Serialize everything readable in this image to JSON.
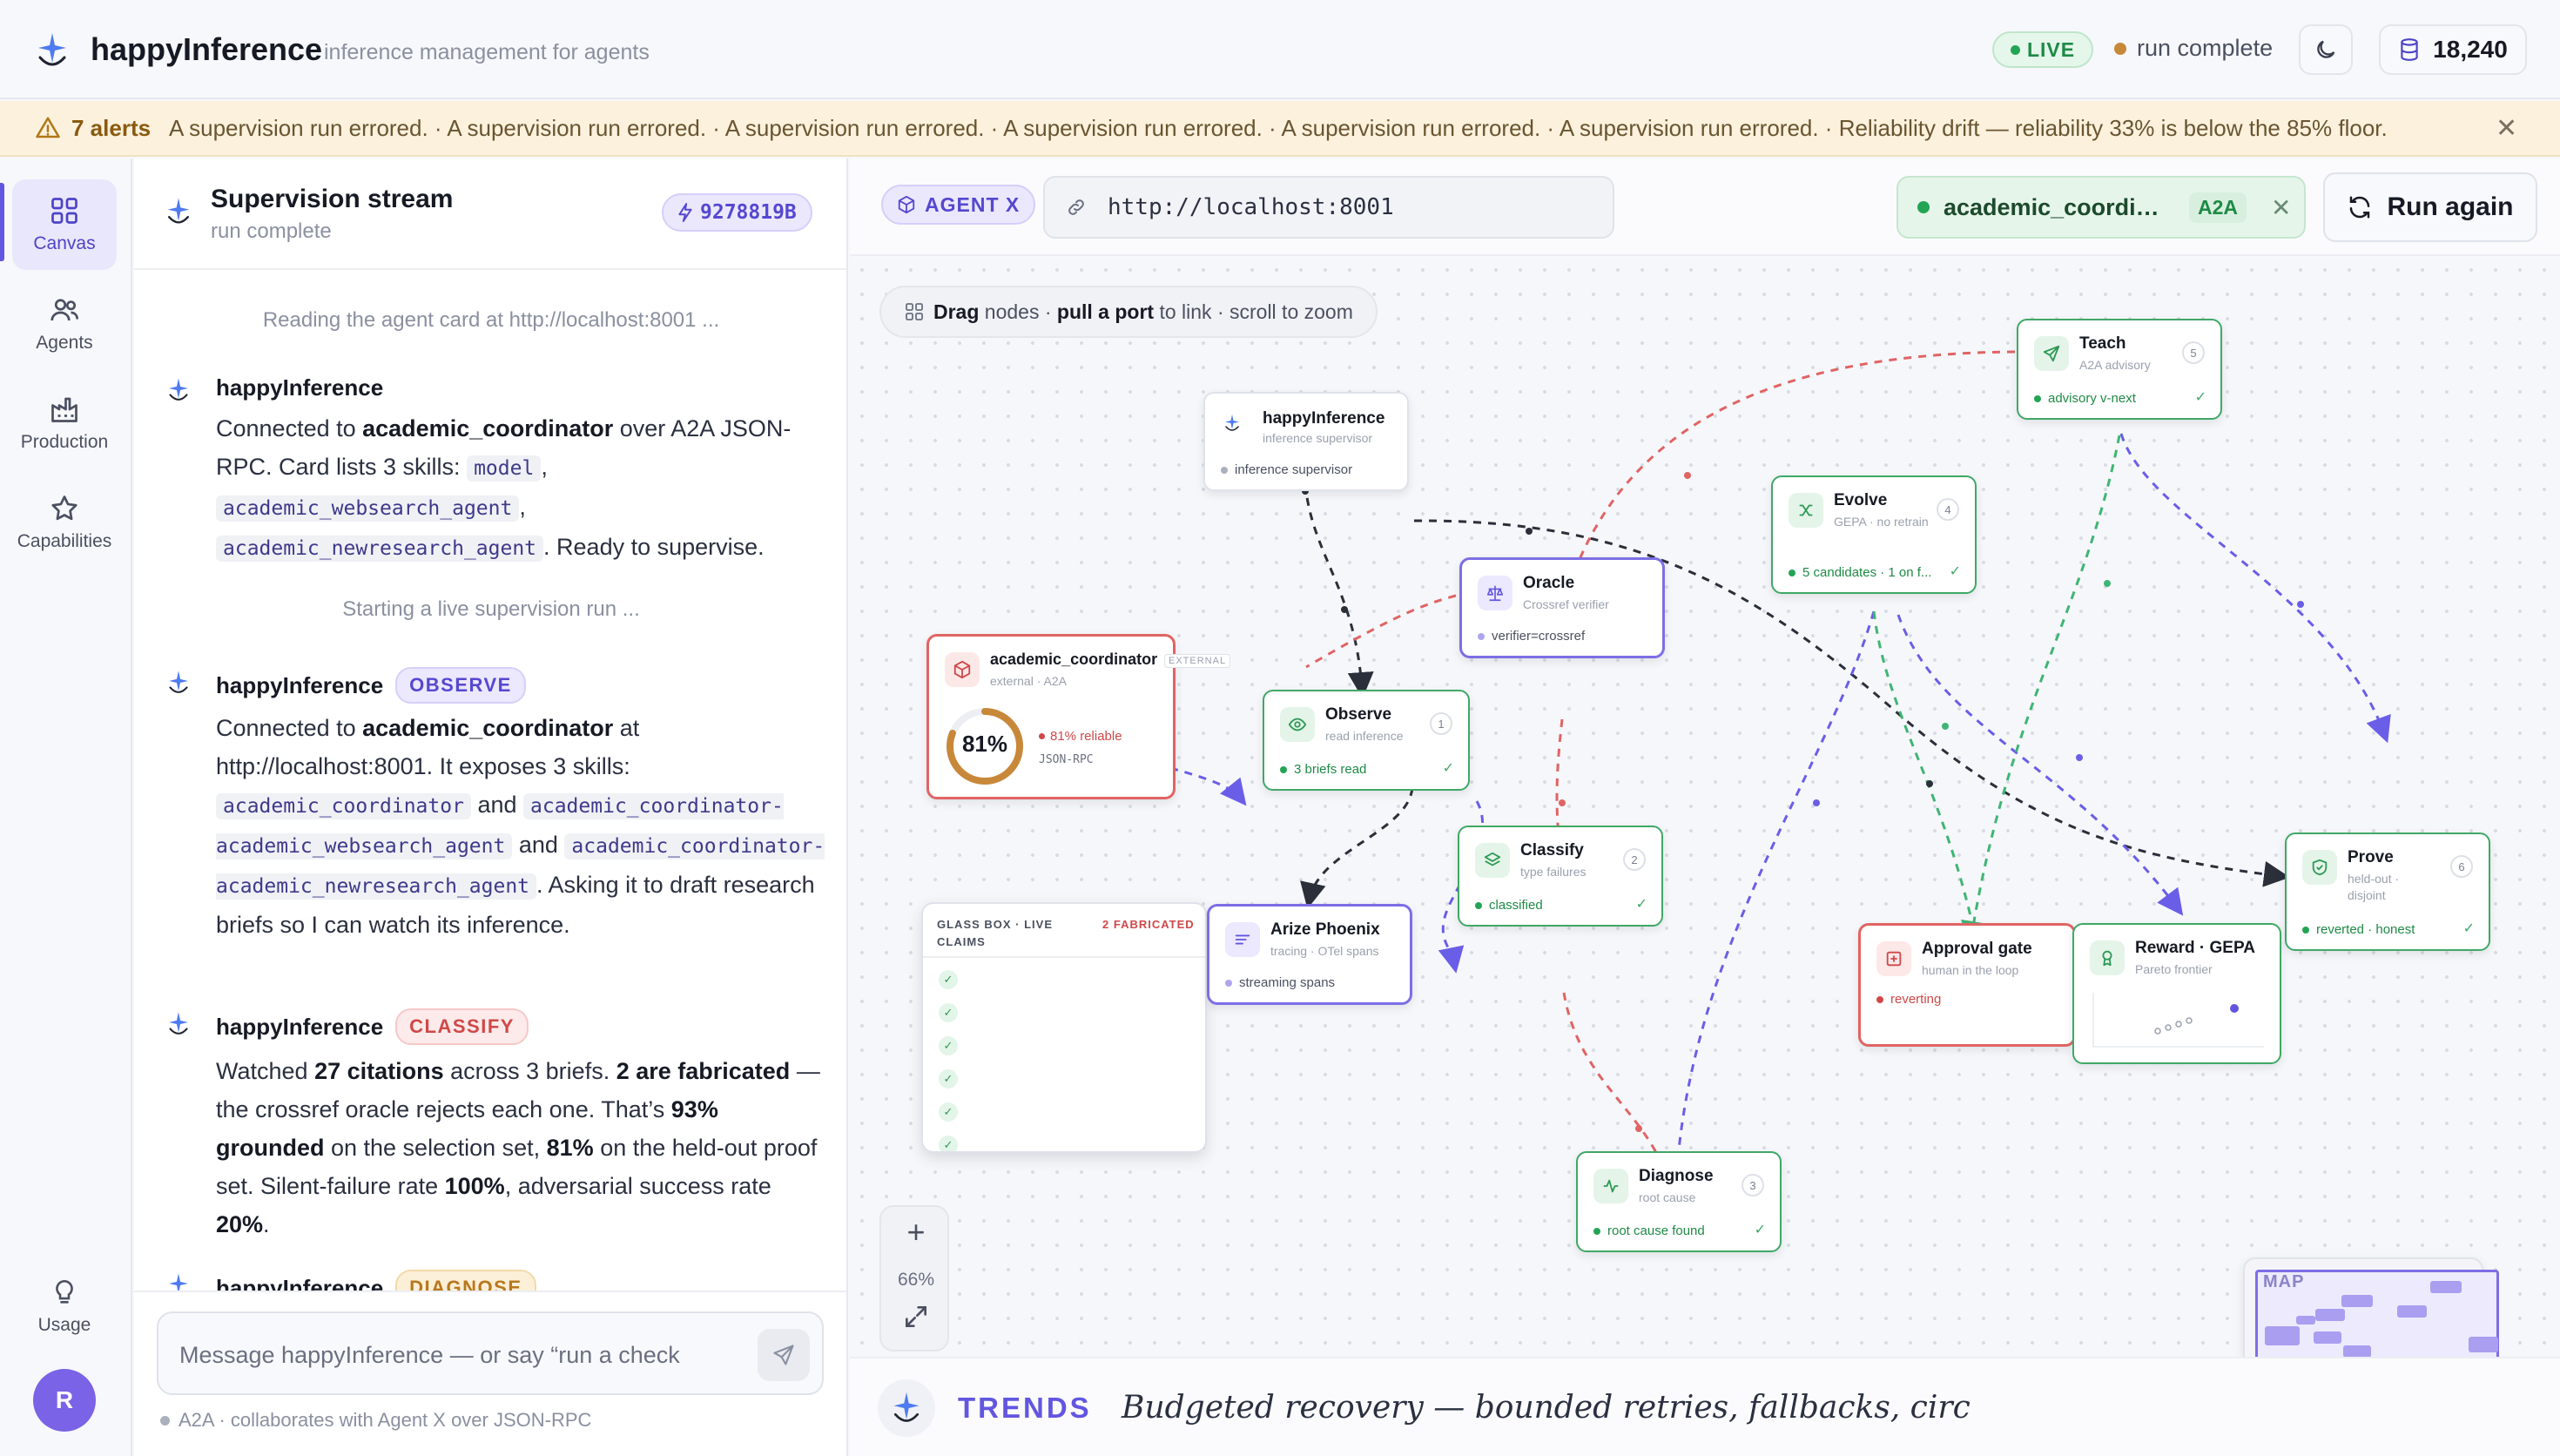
{
  "app": {
    "name": "happyInference",
    "tagline": "inference management for agents",
    "live_label": "LIVE",
    "run_status": "run complete",
    "credits": "18,240"
  },
  "alerts": {
    "count_label": "7 alerts",
    "text": "A supervision run errored. · A supervision run errored. · A supervision run errored. · A supervision run errored. · A supervision run errored. · A supervision run errored. · Reliability drift — reliability 33% is below the 85% floor."
  },
  "rail": {
    "items": [
      {
        "label": "Canvas",
        "icon": "grid-icon",
        "active": true
      },
      {
        "label": "Agents",
        "icon": "users-icon"
      },
      {
        "label": "Production",
        "icon": "factory-icon"
      },
      {
        "label": "Capabilities",
        "icon": "star-icon"
      }
    ],
    "usage_label": "Usage",
    "avatar_initial": "R"
  },
  "stream": {
    "title": "Supervision stream",
    "subtitle": "run complete",
    "run_hash": "9278819B",
    "system_line_1": "Reading the agent card at http://localhost:8001 ...",
    "system_line_2": "Starting a live supervision run ...",
    "author": "happyInference",
    "msg1": {
      "p1": "Connected to ",
      "agent": "academic_coordinator",
      "p2": " over A2A JSON-RPC. Card lists 3 skills: ",
      "skill1": "model",
      "skill2": "academic_websearch_agent",
      "skill3": "academic_newresearch_agent",
      "p3": ". Ready to supervise."
    },
    "msg2": {
      "tag": "OBSERVE",
      "p1": "Connected to ",
      "agent": "academic_coordinator",
      "p2": " at http://localhost:8001. It exposes 3 skills: ",
      "skill1": "academic_coordinator",
      "and1": " and ",
      "skill2": "academic_coordinator-academic_websearch_agent",
      "and2": " and ",
      "skill3": "academic_coordinator-academic_newresearch_agent",
      "p3": ". Asking it to draft research briefs so I can watch its inference."
    },
    "msg3": {
      "tag": "CLASSIFY",
      "p1": "Watched ",
      "b1": "27 citations",
      "p2": " across 3 briefs. ",
      "b2": "2 are fabricated",
      "p3": " — the crossref oracle rejects each one. That’s ",
      "b3": "93% grounded",
      "p4": " on the selection set, ",
      "b4": "81%",
      "p5": " on the held-out proof set. Silent-failure rate ",
      "b5": "100%",
      "p6": ", adversarial success rate ",
      "b6": "20%",
      "p7": "."
    },
    "msg4": {
      "tag": "DIAGNOSE"
    },
    "composer_placeholder": "Message happyInference — or say “run a check",
    "footer": "A2A · collaborates with Agent X over JSON-RPC"
  },
  "canvas": {
    "agent_badge": "AGENT X",
    "url": "http://localhost:8001",
    "connection": {
      "name": "academic_coordinator",
      "protocol": "A2A"
    },
    "run_again_label": "Run again",
    "hint": {
      "b1": "Drag",
      "t1": " nodes · ",
      "b2": "pull a port",
      "t2": " to link · scroll to zoom"
    },
    "zoom_level": "66%",
    "minimap_label": "MAP",
    "nodes": {
      "supervisor": {
        "title": "happyInference",
        "sub": "inference supervisor",
        "status": "inference supervisor"
      },
      "coordinator": {
        "title": "academic_coordinator",
        "badge": "EXTERNAL",
        "sub": "external · A2A",
        "score": "81%",
        "reliability": "81% reliable",
        "protocol": "JSON-RPC",
        "reliability_value": 0.81
      },
      "observe": {
        "title": "Observe",
        "sub": "read inference",
        "step": "1",
        "status": "3 briefs read"
      },
      "oracle": {
        "title": "Oracle",
        "sub": "Crossref verifier",
        "status": "verifier=crossref"
      },
      "classify": {
        "title": "Classify",
        "sub": "type failures",
        "step": "2",
        "status": "classified"
      },
      "phoenix": {
        "title": "Arize Phoenix",
        "sub": "tracing · OTel spans",
        "status": "streaming spans"
      },
      "diagnose": {
        "title": "Diagnose",
        "sub": "root cause",
        "step": "3",
        "status": "root cause found"
      },
      "evolve": {
        "title": "Evolve",
        "sub": "GEPA · no retrain",
        "step": "4",
        "status": "5 candidates · 1 on f..."
      },
      "teach": {
        "title": "Teach",
        "sub": "A2A advisory",
        "step": "5",
        "status": "advisory v-next"
      },
      "prove": {
        "title": "Prove",
        "sub": "held-out · disjoint",
        "step": "6",
        "status": "reverted · honest"
      },
      "approval": {
        "title": "Approval gate",
        "sub": "human in the loop",
        "status": "reverting"
      },
      "reward": {
        "title": "Reward · GEPA",
        "sub": "Pareto frontier"
      }
    },
    "glassbox": {
      "title": "GLASS BOX · LIVE CLAIMS",
      "flag": "2 FABRICATED"
    }
  },
  "trends": {
    "label": "TRENDS",
    "text": "Budgeted recovery — bounded retries, fallbacks, circ"
  },
  "colors": {
    "accent": "#6256e0",
    "success": "#23a455",
    "danger": "#d04848",
    "warning": "#c8883a"
  }
}
